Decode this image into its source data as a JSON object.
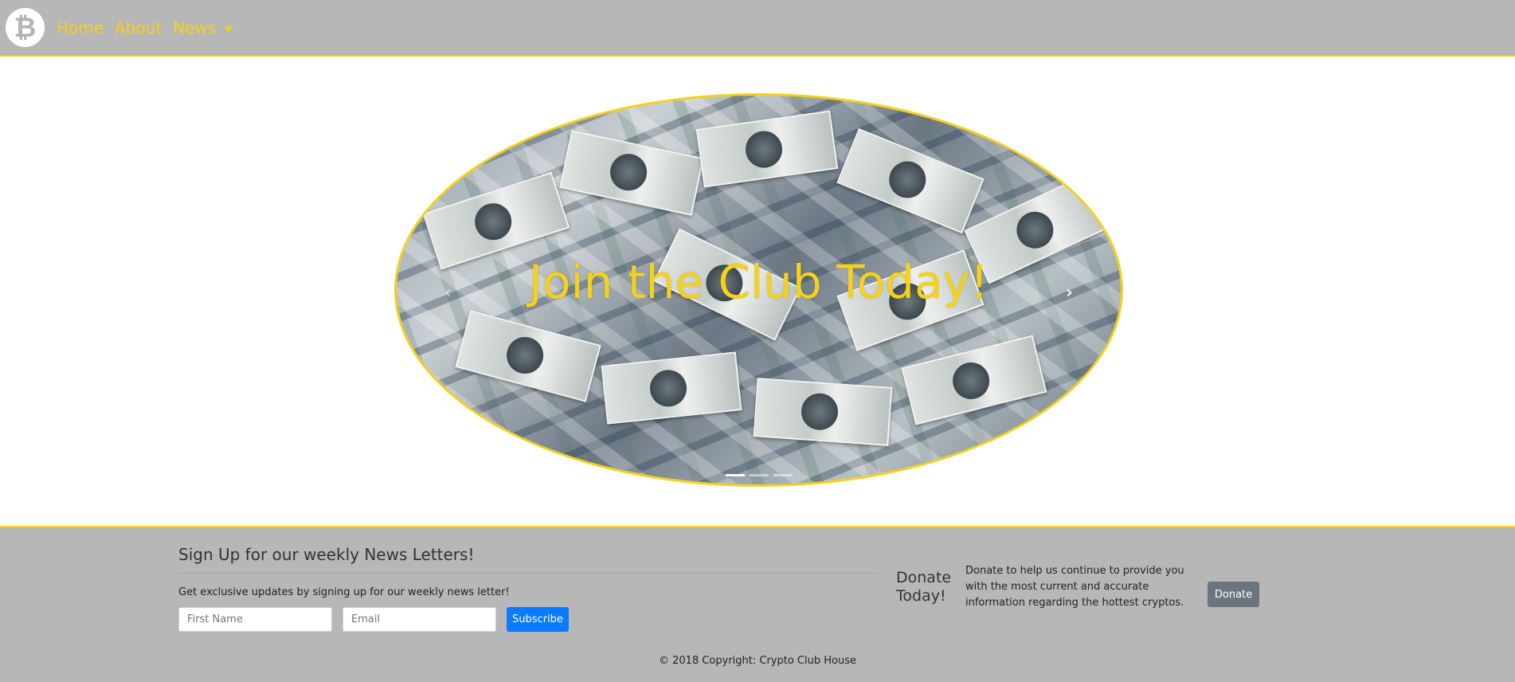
{
  "navbar": {
    "logo_glyph": "₿",
    "links": [
      {
        "label": "Home"
      },
      {
        "label": "About"
      },
      {
        "label": "News"
      }
    ],
    "accent_color": "#f5d11c",
    "background_color": "#b7b7b7"
  },
  "hero": {
    "caption": "Join the Club Today!",
    "prev_glyph": "‹",
    "next_glyph": "›",
    "active_slide": 1,
    "slide_count": 3
  },
  "footer": {
    "signup": {
      "title": "Sign Up for our weekly News Letters!",
      "description": "Get exclusive updates by signing up for our weekly news letter!",
      "first_name_placeholder": "First Name",
      "email_placeholder": "Email",
      "subscribe_label": "Subscribe"
    },
    "donate": {
      "title": "Donate Today!",
      "text": "Donate to help us continue to provide you with the most current and accurate information regarding the hottest cryptos.",
      "button_label": "Donate"
    },
    "copyright": "© 2018 Copyright: Crypto Club House"
  }
}
